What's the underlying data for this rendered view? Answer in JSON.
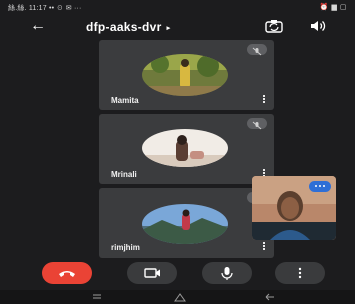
{
  "status_bar": {
    "left_text": "絲.絲. 11:17 •• ☉ ✉ ···",
    "right_text": "⏰ ▆ ▢"
  },
  "header": {
    "back_icon": "arrow-left-icon",
    "meeting_code": "dfp-aaks-dvr",
    "meeting_caret": "▸"
  },
  "participants": [
    {
      "name": "Mamita",
      "muted": true
    },
    {
      "name": "Mrinali",
      "muted": true
    },
    {
      "name": "rimjhim",
      "muted": true
    }
  ],
  "self_view": {
    "badge_icon": "more-dots-icon"
  },
  "controls": [
    {
      "name": "end-call-button",
      "icon": "phone-hangup-icon",
      "color": "#ea4335"
    },
    {
      "name": "camera-button",
      "icon": "video-camera-icon"
    },
    {
      "name": "microphone-button",
      "icon": "microphone-icon"
    },
    {
      "name": "more-options-button",
      "icon": "more-vert-icon"
    }
  ],
  "colors": {
    "background": "#1c1c1e",
    "tile": "#3b3c3e",
    "accent": "#2f6fd6",
    "end_call": "#ea4335"
  }
}
